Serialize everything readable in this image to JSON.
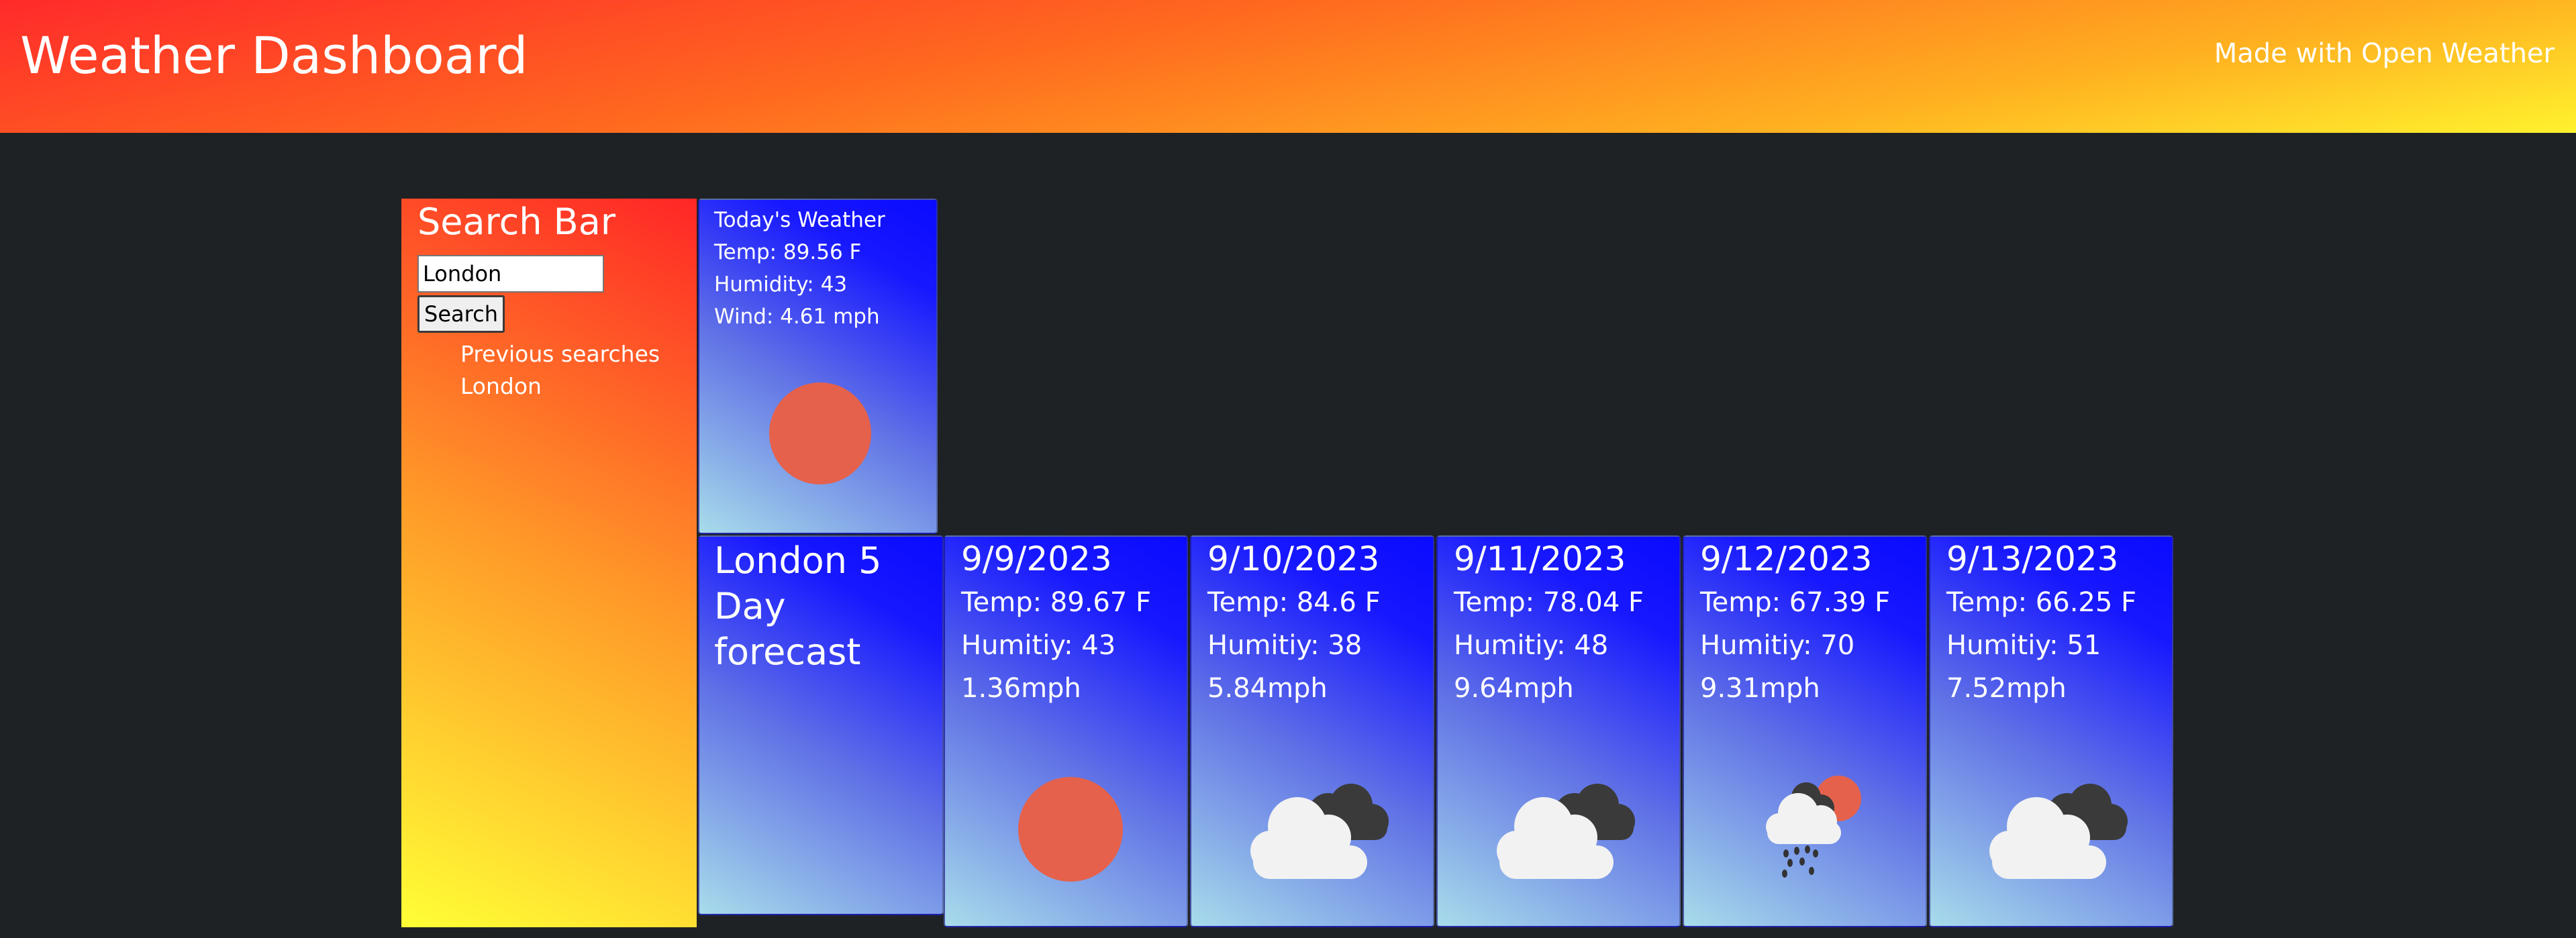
{
  "header": {
    "title": "Weather Dashboard",
    "credit": "Made with Open Weather"
  },
  "sidebar": {
    "title": "Search Bar",
    "search_value": "London",
    "search_button": "Search",
    "history_heading": "Previous searches",
    "history": [
      "London"
    ]
  },
  "today": {
    "heading": "Today's Weather",
    "temp": "Temp: 89.56 F",
    "humidity": "Humidity: 43",
    "wind": "Wind: 4.61 mph",
    "icon": "sun-icon"
  },
  "forecast": {
    "title": "London 5 Day forecast",
    "days": [
      {
        "date": "9/9/2023",
        "temp": "Temp: 89.67 F",
        "humidity": "Humitiy: 43",
        "wind": "1.36mph",
        "icon": "sun-icon"
      },
      {
        "date": "9/10/2023",
        "temp": "Temp: 84.6 F",
        "humidity": "Humitiy: 38",
        "wind": "5.84mph",
        "icon": "clouds-icon"
      },
      {
        "date": "9/11/2023",
        "temp": "Temp: 78.04 F",
        "humidity": "Humitiy: 48",
        "wind": "9.64mph",
        "icon": "clouds-icon"
      },
      {
        "date": "9/12/2023",
        "temp": "Temp: 67.39 F",
        "humidity": "Humitiy: 70",
        "wind": "9.31mph",
        "icon": "rain-sun-icon"
      },
      {
        "date": "9/13/2023",
        "temp": "Temp: 66.25 F",
        "humidity": "Humitiy: 51",
        "wind": "7.52mph",
        "icon": "clouds-icon"
      }
    ]
  },
  "colors": {
    "background": "#1f2225",
    "sun": "#e5614b",
    "card_blue": "#1717ff",
    "header_red": "#ff2a2a",
    "header_yellow": "#fff22e"
  }
}
